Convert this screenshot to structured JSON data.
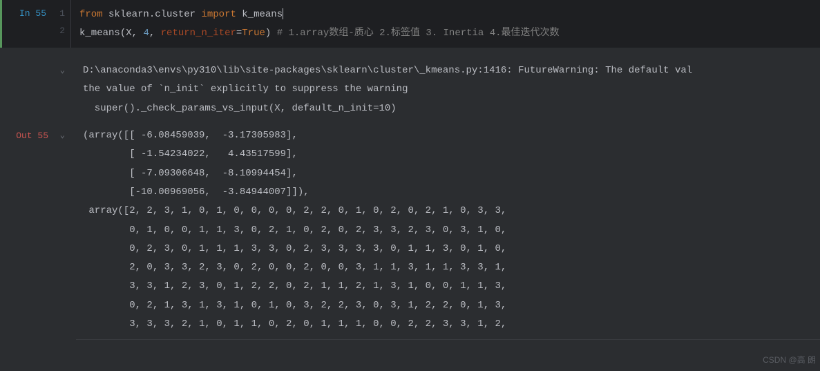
{
  "cell": {
    "in_label": "In 55",
    "out_label": "Out 55",
    "line_numbers": [
      "1",
      "2"
    ]
  },
  "code": {
    "kw_from": "from",
    "module": "sklearn.cluster",
    "kw_import": "import",
    "import_name": "k_means",
    "call_func": "k_means",
    "arg_x": "X",
    "arg_n": "4",
    "arg_param": "return_n_iter",
    "arg_true": "True",
    "comment": "# 1.array数组-质心 2.标签值 3. Inertia 4.最佳迭代次数"
  },
  "warning": {
    "line1": "D:\\anaconda3\\envs\\py310\\lib\\site-packages\\sklearn\\cluster\\_kmeans.py:1416: FutureWarning: The default val",
    "line2": "the value of `n_init` explicitly to suppress the warning",
    "line3": "  super()._check_params_vs_input(X, default_n_init=10)"
  },
  "output": {
    "line1": "(array([[ -6.08459039,  -3.17305983],",
    "line2": "        [ -1.54234022,   4.43517599],",
    "line3": "        [ -7.09306648,  -8.10994454],",
    "line4": "        [-10.00969056,  -3.84944007]]),",
    "line5": " array([2, 2, 3, 1, 0, 1, 0, 0, 0, 0, 2, 2, 0, 1, 0, 2, 0, 2, 1, 0, 3, 3,",
    "line6": "        0, 1, 0, 0, 1, 1, 3, 0, 2, 1, 0, 2, 0, 2, 3, 3, 2, 3, 0, 3, 1, 0,",
    "line7": "        0, 2, 3, 0, 1, 1, 1, 3, 3, 0, 2, 3, 3, 3, 3, 0, 1, 1, 3, 0, 1, 0,",
    "line8": "        2, 0, 3, 3, 2, 3, 0, 2, 0, 0, 2, 0, 0, 3, 1, 1, 3, 1, 1, 3, 3, 1,",
    "line9": "        3, 3, 1, 2, 3, 0, 1, 2, 2, 0, 2, 1, 1, 2, 1, 3, 1, 0, 0, 1, 1, 3,",
    "line10": "        0, 2, 1, 3, 1, 3, 1, 0, 1, 0, 3, 2, 2, 3, 0, 3, 1, 2, 2, 0, 1, 3,",
    "line11": "        3, 3, 3, 2, 1, 0, 1, 1, 0, 2, 0, 1, 1, 1, 0, 0, 2, 2, 3, 3, 1, 2,"
  },
  "watermark": "CSDN @高 朗"
}
